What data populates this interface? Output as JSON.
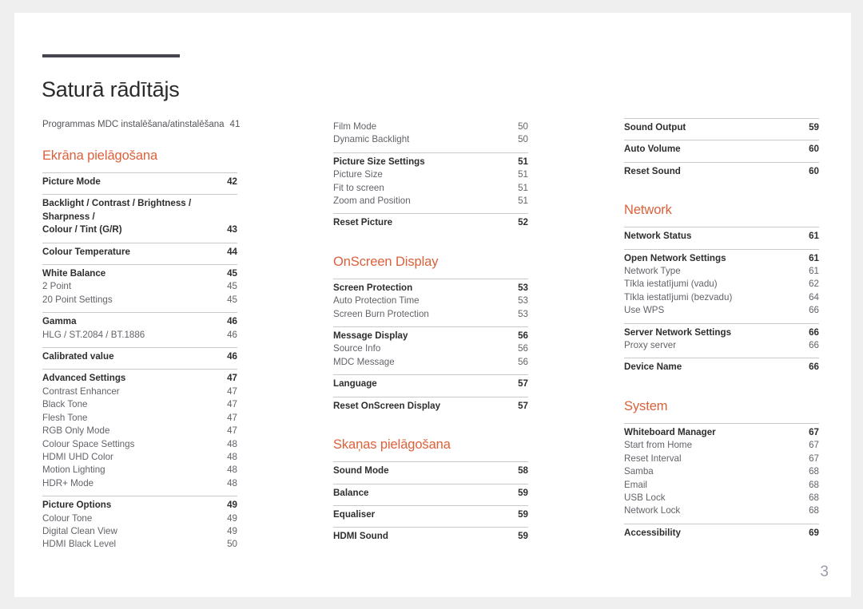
{
  "document": {
    "title": "Saturā rādītājs",
    "page_number": "3"
  },
  "accent_color": "#dc603a",
  "rule_color": "#45454f",
  "intro": {
    "label": "Programmas MDC instalēšana/atinstalēšana",
    "page": "41"
  },
  "columns": [
    {
      "id": "column-1",
      "blocks": [
        {
          "type": "heading",
          "text": "Ekrāna pielāgošana"
        },
        {
          "type": "group",
          "rows": [
            {
              "label": "Picture Mode",
              "page": "42",
              "level": "main"
            }
          ]
        },
        {
          "type": "group",
          "rows": [
            {
              "label": "Backlight / Contrast / Brightness / Sharpness / Colour / Tint (G/R)",
              "page": "43",
              "level": "main",
              "wrap": true,
              "line1": "Backlight / Contrast / Brightness / Sharpness /",
              "line2": "Colour / Tint (G/R)"
            }
          ]
        },
        {
          "type": "group",
          "rows": [
            {
              "label": "Colour Temperature",
              "page": "44",
              "level": "main"
            }
          ]
        },
        {
          "type": "group",
          "rows": [
            {
              "label": "White Balance",
              "page": "45",
              "level": "main"
            },
            {
              "label": "2 Point",
              "page": "45",
              "level": "sub"
            },
            {
              "label": "20 Point Settings",
              "page": "45",
              "level": "sub"
            }
          ]
        },
        {
          "type": "group",
          "rows": [
            {
              "label": "Gamma",
              "page": "46",
              "level": "main"
            },
            {
              "label": "HLG / ST.2084 / BT.1886",
              "page": "46",
              "level": "sub"
            }
          ]
        },
        {
          "type": "group",
          "rows": [
            {
              "label": "Calibrated value",
              "page": "46",
              "level": "main"
            }
          ]
        },
        {
          "type": "group",
          "rows": [
            {
              "label": "Advanced Settings",
              "page": "47",
              "level": "main"
            },
            {
              "label": "Contrast Enhancer",
              "page": "47",
              "level": "sub"
            },
            {
              "label": "Black Tone",
              "page": "47",
              "level": "sub"
            },
            {
              "label": "Flesh Tone",
              "page": "47",
              "level": "sub"
            },
            {
              "label": "RGB Only Mode",
              "page": "47",
              "level": "sub"
            },
            {
              "label": "Colour Space Settings",
              "page": "48",
              "level": "sub"
            },
            {
              "label": "HDMI UHD Color",
              "page": "48",
              "level": "sub"
            },
            {
              "label": "Motion Lighting",
              "page": "48",
              "level": "sub"
            },
            {
              "label": "HDR+ Mode",
              "page": "48",
              "level": "sub"
            }
          ]
        },
        {
          "type": "group",
          "rows": [
            {
              "label": "Picture Options",
              "page": "49",
              "level": "main"
            },
            {
              "label": "Colour Tone",
              "page": "49",
              "level": "sub"
            },
            {
              "label": "Digital Clean View",
              "page": "49",
              "level": "sub"
            },
            {
              "label": "HDMI Black Level",
              "page": "50",
              "level": "sub"
            }
          ]
        }
      ]
    },
    {
      "id": "column-2",
      "blocks": [
        {
          "type": "group",
          "no_rule": true,
          "rows": [
            {
              "label": "Film Mode",
              "page": "50",
              "level": "sub"
            },
            {
              "label": "Dynamic Backlight",
              "page": "50",
              "level": "sub"
            }
          ]
        },
        {
          "type": "group",
          "rows": [
            {
              "label": "Picture Size Settings",
              "page": "51",
              "level": "main"
            },
            {
              "label": "Picture Size",
              "page": "51",
              "level": "sub"
            },
            {
              "label": "Fit to screen",
              "page": "51",
              "level": "sub"
            },
            {
              "label": "Zoom and Position",
              "page": "51",
              "level": "sub"
            }
          ]
        },
        {
          "type": "group",
          "rows": [
            {
              "label": "Reset Picture",
              "page": "52",
              "level": "main"
            }
          ]
        },
        {
          "type": "heading",
          "text": "OnScreen Display"
        },
        {
          "type": "group",
          "rows": [
            {
              "label": "Screen Protection",
              "page": "53",
              "level": "main"
            },
            {
              "label": "Auto Protection Time",
              "page": "53",
              "level": "sub"
            },
            {
              "label": "Screen Burn Protection",
              "page": "53",
              "level": "sub"
            }
          ]
        },
        {
          "type": "group",
          "rows": [
            {
              "label": "Message Display",
              "page": "56",
              "level": "main"
            },
            {
              "label": "Source Info",
              "page": "56",
              "level": "sub"
            },
            {
              "label": "MDC Message",
              "page": "56",
              "level": "sub"
            }
          ]
        },
        {
          "type": "group",
          "rows": [
            {
              "label": "Language",
              "page": "57",
              "level": "main"
            }
          ]
        },
        {
          "type": "group",
          "rows": [
            {
              "label": "Reset OnScreen Display",
              "page": "57",
              "level": "main"
            }
          ]
        },
        {
          "type": "heading",
          "text": "Skaņas pielāgošana"
        },
        {
          "type": "group",
          "rows": [
            {
              "label": "Sound Mode",
              "page": "58",
              "level": "main"
            }
          ]
        },
        {
          "type": "group",
          "rows": [
            {
              "label": "Balance",
              "page": "59",
              "level": "main"
            }
          ]
        },
        {
          "type": "group",
          "rows": [
            {
              "label": "Equaliser",
              "page": "59",
              "level": "main"
            }
          ]
        },
        {
          "type": "group",
          "rows": [
            {
              "label": "HDMI Sound",
              "page": "59",
              "level": "main"
            }
          ]
        }
      ]
    },
    {
      "id": "column-3",
      "blocks": [
        {
          "type": "group",
          "rows": [
            {
              "label": "Sound Output",
              "page": "59",
              "level": "main"
            }
          ]
        },
        {
          "type": "group",
          "rows": [
            {
              "label": "Auto Volume",
              "page": "60",
              "level": "main"
            }
          ]
        },
        {
          "type": "group",
          "rows": [
            {
              "label": "Reset Sound",
              "page": "60",
              "level": "main"
            }
          ]
        },
        {
          "type": "heading",
          "text": "Network"
        },
        {
          "type": "group",
          "rows": [
            {
              "label": "Network Status",
              "page": "61",
              "level": "main"
            }
          ]
        },
        {
          "type": "group",
          "rows": [
            {
              "label": "Open Network Settings",
              "page": "61",
              "level": "main"
            },
            {
              "label": "Network Type",
              "page": "61",
              "level": "sub"
            },
            {
              "label": "Tīkla iestatījumi (vadu)",
              "page": "62",
              "level": "sub"
            },
            {
              "label": "Tīkla iestatījumi (bezvadu)",
              "page": "64",
              "level": "sub"
            },
            {
              "label": "Use WPS",
              "page": "66",
              "level": "sub"
            }
          ]
        },
        {
          "type": "group",
          "rows": [
            {
              "label": "Server Network Settings",
              "page": "66",
              "level": "main"
            },
            {
              "label": "Proxy server",
              "page": "66",
              "level": "sub"
            }
          ]
        },
        {
          "type": "group",
          "rows": [
            {
              "label": "Device Name",
              "page": "66",
              "level": "main"
            }
          ]
        },
        {
          "type": "heading",
          "text": "System"
        },
        {
          "type": "group",
          "rows": [
            {
              "label": "Whiteboard Manager",
              "page": "67",
              "level": "main"
            },
            {
              "label": "Start from Home",
              "page": "67",
              "level": "sub"
            },
            {
              "label": "Reset Interval",
              "page": "67",
              "level": "sub"
            },
            {
              "label": "Samba",
              "page": "68",
              "level": "sub"
            },
            {
              "label": "Email",
              "page": "68",
              "level": "sub"
            },
            {
              "label": "USB Lock",
              "page": "68",
              "level": "sub"
            },
            {
              "label": "Network Lock",
              "page": "68",
              "level": "sub"
            }
          ]
        },
        {
          "type": "group",
          "rows": [
            {
              "label": "Accessibility",
              "page": "69",
              "level": "main"
            }
          ]
        }
      ]
    }
  ]
}
